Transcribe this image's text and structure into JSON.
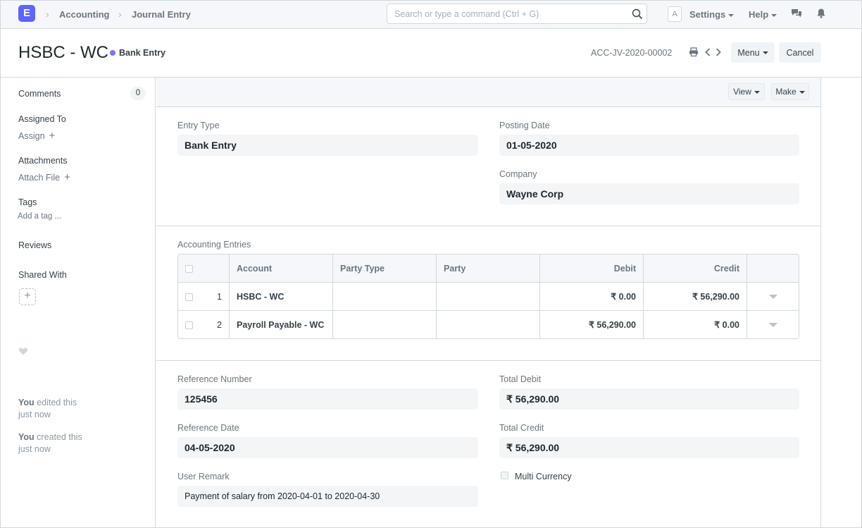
{
  "navbar": {
    "logo_letter": "E",
    "breadcrumbs": [
      "Accounting",
      "Journal Entry"
    ],
    "search_placeholder": "Search or type a command (Ctrl + G)",
    "avatar_letter": "A",
    "settings_label": "Settings",
    "help_label": "Help",
    "icons": [
      "search-icon",
      "chat-icon",
      "bell-icon"
    ]
  },
  "header": {
    "title": "HSBC - WC",
    "status": "Bank Entry",
    "status_color": "#7575ff",
    "doc_id": "ACC-JV-2020-00002",
    "menu_label": "Menu",
    "cancel_label": "Cancel"
  },
  "sidebar": {
    "comments_label": "Comments",
    "comments_count": "0",
    "assigned_label": "Assigned To",
    "assign_link": "Assign",
    "attachments_label": "Attachments",
    "attach_link": "Attach File",
    "tags_label": "Tags",
    "add_tag_link": "Add a tag ...",
    "reviews_label": "Reviews",
    "shared_label": "Shared With",
    "timeline": [
      {
        "who": "You",
        "action": " edited this",
        "when": "just now"
      },
      {
        "who": "You",
        "action": " created this",
        "when": "just now"
      }
    ]
  },
  "form_bar": {
    "view_label": "View",
    "make_label": "Make"
  },
  "fields": {
    "entry_type_label": "Entry Type",
    "entry_type_value": "Bank Entry",
    "posting_date_label": "Posting Date",
    "posting_date_value": "01-05-2020",
    "company_label": "Company",
    "company_value": "Wayne Corp",
    "accounting_entries_label": "Accounting Entries",
    "reference_number_label": "Reference Number",
    "reference_number_value": "125456",
    "reference_date_label": "Reference Date",
    "reference_date_value": "04-05-2020",
    "user_remark_label": "User Remark",
    "user_remark_value": "Payment of salary from 2020-04-01 to 2020-04-30",
    "total_debit_label": "Total Debit",
    "total_debit_value": "₹ 56,290.00",
    "total_credit_label": "Total Credit",
    "total_credit_value": "₹ 56,290.00",
    "multi_currency_label": "Multi Currency"
  },
  "table": {
    "columns": [
      "Account",
      "Party Type",
      "Party",
      "Debit",
      "Credit"
    ],
    "rows": [
      {
        "idx": "1",
        "account": "HSBC - WC",
        "party_type": "",
        "party": "",
        "debit": "₹ 0.00",
        "credit": "₹ 56,290.00"
      },
      {
        "idx": "2",
        "account": "Payroll Payable - WC",
        "party_type": "",
        "party": "",
        "debit": "₹ 56,290.00",
        "credit": "₹ 0.00"
      }
    ]
  }
}
